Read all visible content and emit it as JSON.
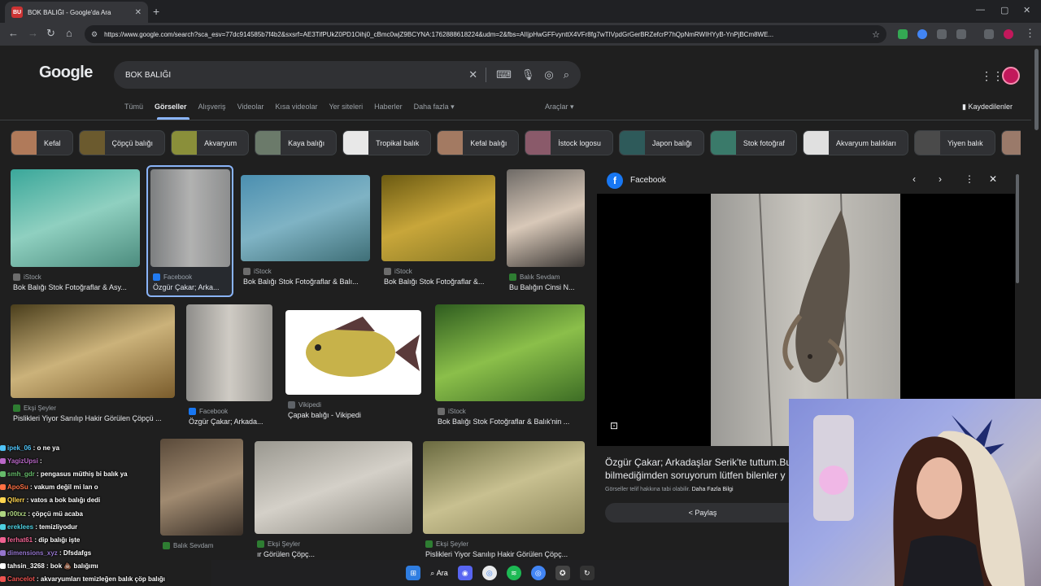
{
  "browser": {
    "tab_title": "BOK BALIĞI - Google'da Ara",
    "tab_favicon_text": "BU",
    "url": "https://www.google.com/search?sca_esv=77dc914585b7f4b2&sxsrf=AE3TifPUkZ0PD1Oihj0_cBmc0wjZ9BCYNA:1762888618224&udm=2&fbs=AIIjpHwGFFvynttX4VFr8fg7wTIVpdGrGerBRZefcrP7hQpNmRWIHYyB-YnPjBCm8WE..."
  },
  "google": {
    "logo": "Google",
    "query": "BOK BALIĞI",
    "tabs": [
      "Tümü",
      "Görseller",
      "Alışveriş",
      "Videolar",
      "Kısa videolar",
      "Yer siteleri",
      "Haberler",
      "Daha fazla ▾"
    ],
    "tools": "Araçlar ▾",
    "saved": "Kaydedilenler"
  },
  "chips": [
    {
      "label": "Kefal",
      "color": "#b07a5a"
    },
    {
      "label": "Çöpçü balığı",
      "color": "#6b5a2e"
    },
    {
      "label": "Akvaryum",
      "color": "#8a8f3a"
    },
    {
      "label": "Kaya balığı",
      "color": "#6b7a6a"
    },
    {
      "label": "Tropikal balık",
      "color": "#e8e8e8"
    },
    {
      "label": "Kefal balığı",
      "color": "#a37a62"
    },
    {
      "label": "İstock logosu",
      "color": "#8a5a6a"
    },
    {
      "label": "Japon balığı",
      "color": "#2e5a5a"
    },
    {
      "label": "Stok fotoğraf",
      "color": "#3a7a6a"
    },
    {
      "label": "Akvaryum balıkları",
      "color": "#e0e0e0"
    },
    {
      "label": "Yiyen balık",
      "color": "#4a4a4a"
    },
    {
      "label": "Bok B",
      "color": "#9a7a6a"
    }
  ],
  "results": [
    {
      "source": "iStock",
      "caption": "Bok Balığı Stok Fotoğraflar & Asy..."
    },
    {
      "source": "Facebook",
      "caption": "Özgür Çakar; Arka..."
    },
    {
      "source": "iStock",
      "caption": "Bok Balığı Stok Fotoğraflar & Balı..."
    },
    {
      "source": "iStock",
      "caption": "Bok Balığı Stok Fotoğraflar &..."
    },
    {
      "source": "Balık Sevdam",
      "caption": "Bu Balığın Cinsi N..."
    },
    {
      "source": "Ekşi Şeyler",
      "caption": "Pislikleri Yiyor Sanılıp Hakir Görülen Çöpçü ..."
    },
    {
      "source": "Facebook",
      "caption": "Özgür Çakar; Arkada..."
    },
    {
      "source": "Vikipedi",
      "caption": "Çapak balığı - Vikipedi"
    },
    {
      "source": "iStock",
      "caption": "Bok Balığı Stok Fotoğraflar & Balık'nin ..."
    },
    {
      "source": "Balık Sevdam",
      "caption": ""
    },
    {
      "source": "Ekşi Şeyler",
      "caption": "ır Görülen Çöpç..."
    },
    {
      "source": "Ekşi Şeyler",
      "caption": "Pislikleri Yiyor Sanılıp Hakir Görülen Çöpç..."
    }
  ],
  "panel": {
    "source": "Facebook",
    "title_line1": "Özgür Çakar; Arkadaşlar Serik'te tuttum.Bu",
    "title_line2": "bilmediğimden soruyorum lütfen bilenler y",
    "copyright": "Görseller telif hakkına tabi olabilir.",
    "more_info": "Daha Fazla Bilgi",
    "share": "Paylaş"
  },
  "chat": [
    {
      "user": "ipek_06",
      "text": "o ne ya",
      "color": "#4fc3f7"
    },
    {
      "user": "YagizUpsi",
      "text": "",
      "color": "#ba68c8"
    },
    {
      "user": "smh_gdr",
      "text": "pengasus müthiş bi balık ya",
      "color": "#66bb6a"
    },
    {
      "user": "ApoSu",
      "text": "vakum değil mi lan o",
      "color": "#ff7043"
    },
    {
      "user": "Qllerr",
      "text": "vatos a bok balığı dedi",
      "color": "#ffd54f"
    },
    {
      "user": "r00txz",
      "text": "çöpçü mü acaba",
      "color": "#aed581"
    },
    {
      "user": "ereklees",
      "text": "temizliyodur",
      "color": "#4dd0e1"
    },
    {
      "user": "ferhat61",
      "text": "dip balığı işte",
      "color": "#f06292"
    },
    {
      "user": "dimensions_xyz",
      "text": "Dfsdafgs",
      "color": "#9575cd"
    },
    {
      "user": "tahsin_3268",
      "text": "bok 💩 balığımı",
      "color": "#ffffff"
    },
    {
      "user": "Cancelot",
      "text": "akvaryumları temizleğen balık çöp balığı",
      "color": "#ef5350"
    }
  ],
  "taskbar": {
    "search": "Ara"
  }
}
